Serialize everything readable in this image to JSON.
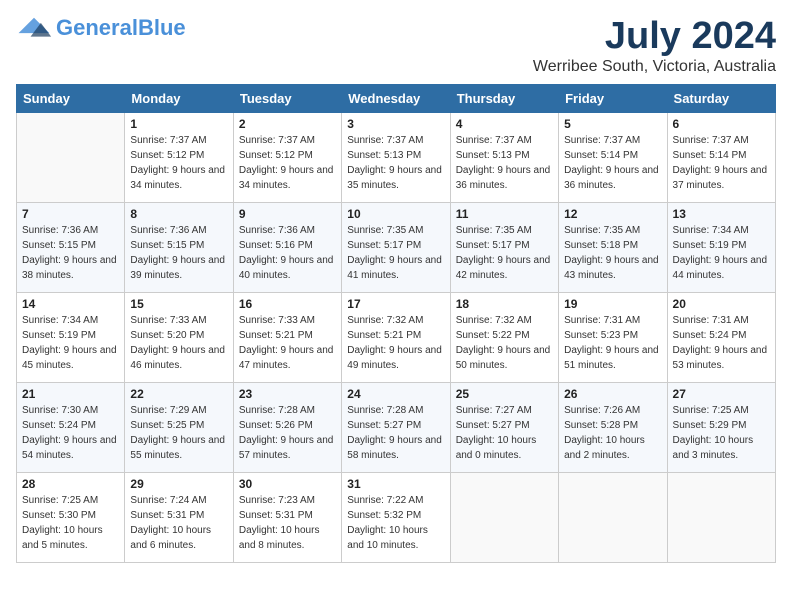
{
  "logo": {
    "part1": "General",
    "part2": "Blue",
    "tagline": ""
  },
  "title": "July 2024",
  "location": "Werribee South, Victoria, Australia",
  "days_of_week": [
    "Sunday",
    "Monday",
    "Tuesday",
    "Wednesday",
    "Thursday",
    "Friday",
    "Saturday"
  ],
  "weeks": [
    [
      {
        "day": "",
        "sunrise": "",
        "sunset": "",
        "daylight": ""
      },
      {
        "day": "1",
        "sunrise": "Sunrise: 7:37 AM",
        "sunset": "Sunset: 5:12 PM",
        "daylight": "Daylight: 9 hours and 34 minutes."
      },
      {
        "day": "2",
        "sunrise": "Sunrise: 7:37 AM",
        "sunset": "Sunset: 5:12 PM",
        "daylight": "Daylight: 9 hours and 34 minutes."
      },
      {
        "day": "3",
        "sunrise": "Sunrise: 7:37 AM",
        "sunset": "Sunset: 5:13 PM",
        "daylight": "Daylight: 9 hours and 35 minutes."
      },
      {
        "day": "4",
        "sunrise": "Sunrise: 7:37 AM",
        "sunset": "Sunset: 5:13 PM",
        "daylight": "Daylight: 9 hours and 36 minutes."
      },
      {
        "day": "5",
        "sunrise": "Sunrise: 7:37 AM",
        "sunset": "Sunset: 5:14 PM",
        "daylight": "Daylight: 9 hours and 36 minutes."
      },
      {
        "day": "6",
        "sunrise": "Sunrise: 7:37 AM",
        "sunset": "Sunset: 5:14 PM",
        "daylight": "Daylight: 9 hours and 37 minutes."
      }
    ],
    [
      {
        "day": "7",
        "sunrise": "Sunrise: 7:36 AM",
        "sunset": "Sunset: 5:15 PM",
        "daylight": "Daylight: 9 hours and 38 minutes."
      },
      {
        "day": "8",
        "sunrise": "Sunrise: 7:36 AM",
        "sunset": "Sunset: 5:15 PM",
        "daylight": "Daylight: 9 hours and 39 minutes."
      },
      {
        "day": "9",
        "sunrise": "Sunrise: 7:36 AM",
        "sunset": "Sunset: 5:16 PM",
        "daylight": "Daylight: 9 hours and 40 minutes."
      },
      {
        "day": "10",
        "sunrise": "Sunrise: 7:35 AM",
        "sunset": "Sunset: 5:17 PM",
        "daylight": "Daylight: 9 hours and 41 minutes."
      },
      {
        "day": "11",
        "sunrise": "Sunrise: 7:35 AM",
        "sunset": "Sunset: 5:17 PM",
        "daylight": "Daylight: 9 hours and 42 minutes."
      },
      {
        "day": "12",
        "sunrise": "Sunrise: 7:35 AM",
        "sunset": "Sunset: 5:18 PM",
        "daylight": "Daylight: 9 hours and 43 minutes."
      },
      {
        "day": "13",
        "sunrise": "Sunrise: 7:34 AM",
        "sunset": "Sunset: 5:19 PM",
        "daylight": "Daylight: 9 hours and 44 minutes."
      }
    ],
    [
      {
        "day": "14",
        "sunrise": "Sunrise: 7:34 AM",
        "sunset": "Sunset: 5:19 PM",
        "daylight": "Daylight: 9 hours and 45 minutes."
      },
      {
        "day": "15",
        "sunrise": "Sunrise: 7:33 AM",
        "sunset": "Sunset: 5:20 PM",
        "daylight": "Daylight: 9 hours and 46 minutes."
      },
      {
        "day": "16",
        "sunrise": "Sunrise: 7:33 AM",
        "sunset": "Sunset: 5:21 PM",
        "daylight": "Daylight: 9 hours and 47 minutes."
      },
      {
        "day": "17",
        "sunrise": "Sunrise: 7:32 AM",
        "sunset": "Sunset: 5:21 PM",
        "daylight": "Daylight: 9 hours and 49 minutes."
      },
      {
        "day": "18",
        "sunrise": "Sunrise: 7:32 AM",
        "sunset": "Sunset: 5:22 PM",
        "daylight": "Daylight: 9 hours and 50 minutes."
      },
      {
        "day": "19",
        "sunrise": "Sunrise: 7:31 AM",
        "sunset": "Sunset: 5:23 PM",
        "daylight": "Daylight: 9 hours and 51 minutes."
      },
      {
        "day": "20",
        "sunrise": "Sunrise: 7:31 AM",
        "sunset": "Sunset: 5:24 PM",
        "daylight": "Daylight: 9 hours and 53 minutes."
      }
    ],
    [
      {
        "day": "21",
        "sunrise": "Sunrise: 7:30 AM",
        "sunset": "Sunset: 5:24 PM",
        "daylight": "Daylight: 9 hours and 54 minutes."
      },
      {
        "day": "22",
        "sunrise": "Sunrise: 7:29 AM",
        "sunset": "Sunset: 5:25 PM",
        "daylight": "Daylight: 9 hours and 55 minutes."
      },
      {
        "day": "23",
        "sunrise": "Sunrise: 7:28 AM",
        "sunset": "Sunset: 5:26 PM",
        "daylight": "Daylight: 9 hours and 57 minutes."
      },
      {
        "day": "24",
        "sunrise": "Sunrise: 7:28 AM",
        "sunset": "Sunset: 5:27 PM",
        "daylight": "Daylight: 9 hours and 58 minutes."
      },
      {
        "day": "25",
        "sunrise": "Sunrise: 7:27 AM",
        "sunset": "Sunset: 5:27 PM",
        "daylight": "Daylight: 10 hours and 0 minutes."
      },
      {
        "day": "26",
        "sunrise": "Sunrise: 7:26 AM",
        "sunset": "Sunset: 5:28 PM",
        "daylight": "Daylight: 10 hours and 2 minutes."
      },
      {
        "day": "27",
        "sunrise": "Sunrise: 7:25 AM",
        "sunset": "Sunset: 5:29 PM",
        "daylight": "Daylight: 10 hours and 3 minutes."
      }
    ],
    [
      {
        "day": "28",
        "sunrise": "Sunrise: 7:25 AM",
        "sunset": "Sunset: 5:30 PM",
        "daylight": "Daylight: 10 hours and 5 minutes."
      },
      {
        "day": "29",
        "sunrise": "Sunrise: 7:24 AM",
        "sunset": "Sunset: 5:31 PM",
        "daylight": "Daylight: 10 hours and 6 minutes."
      },
      {
        "day": "30",
        "sunrise": "Sunrise: 7:23 AM",
        "sunset": "Sunset: 5:31 PM",
        "daylight": "Daylight: 10 hours and 8 minutes."
      },
      {
        "day": "31",
        "sunrise": "Sunrise: 7:22 AM",
        "sunset": "Sunset: 5:32 PM",
        "daylight": "Daylight: 10 hours and 10 minutes."
      },
      {
        "day": "",
        "sunrise": "",
        "sunset": "",
        "daylight": ""
      },
      {
        "day": "",
        "sunrise": "",
        "sunset": "",
        "daylight": ""
      },
      {
        "day": "",
        "sunrise": "",
        "sunset": "",
        "daylight": ""
      }
    ]
  ]
}
